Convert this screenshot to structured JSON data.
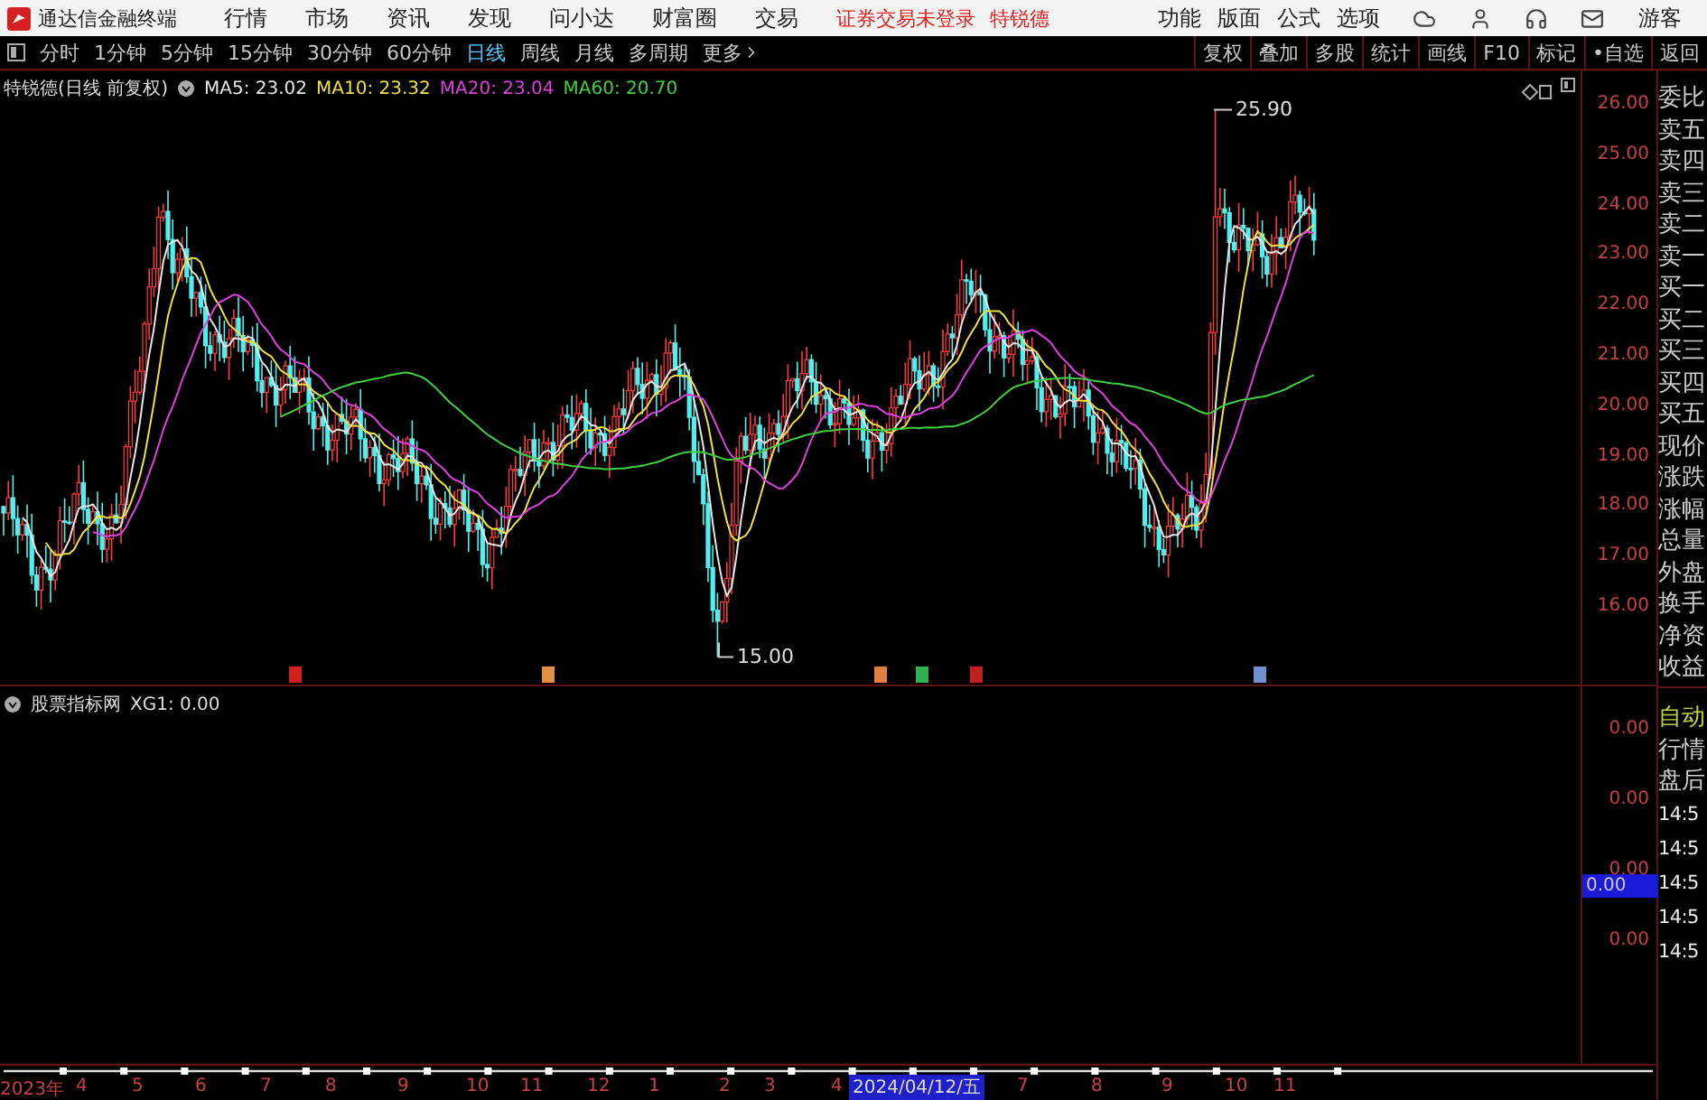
{
  "title_bar": {
    "app_name": "通达信金融终端",
    "menu": [
      "行情",
      "市场",
      "资讯",
      "发现",
      "问小达",
      "财富圈",
      "交易"
    ],
    "status": "证券交易未登录",
    "stock": "特锐德",
    "right_menu": [
      "功能",
      "版面",
      "公式",
      "选项"
    ],
    "user": "游客"
  },
  "period_tabs": [
    {
      "label": "分时",
      "selected": false
    },
    {
      "label": "1分钟",
      "selected": false
    },
    {
      "label": "5分钟",
      "selected": false
    },
    {
      "label": "15分钟",
      "selected": false
    },
    {
      "label": "30分钟",
      "selected": false
    },
    {
      "label": "60分钟",
      "selected": false
    },
    {
      "label": "日线",
      "selected": true
    },
    {
      "label": "周线",
      "selected": false
    },
    {
      "label": "月线",
      "selected": false
    },
    {
      "label": "多周期",
      "selected": false
    },
    {
      "label": "更多",
      "selected": false
    }
  ],
  "tools": [
    "复权",
    "叠加",
    "多股",
    "统计",
    "画线",
    "F10",
    "标记",
    "•自选",
    "返回"
  ],
  "price_panel": {
    "title": "特锐德(日线 前复权)",
    "moving_averages": [
      {
        "label": "MA5: 23.02",
        "color": "#e6e6e6"
      },
      {
        "label": "MA10: 23.32",
        "color": "#f0e040"
      },
      {
        "label": "MA20: 23.04",
        "color": "#e040e0"
      },
      {
        "label": "MA60: 20.70",
        "color": "#40d040"
      }
    ],
    "high_label": "25.90",
    "low_label": "15.00",
    "axis_labels": [
      "26.00",
      "25.00",
      "24.00",
      "23.00",
      "22.00",
      "21.00",
      "20.00",
      "19.00",
      "18.00",
      "17.00",
      "16.00"
    ]
  },
  "indicator_panel": {
    "title": "股票指标网",
    "reading": "XG1: 0.00",
    "axis_labels": [
      "0.00",
      "0.00",
      "0.00",
      "0.00"
    ],
    "cursor_value": "0.00"
  },
  "time_axis": {
    "labels": [
      "2023年",
      "4",
      "5",
      "6",
      "7",
      "8",
      "9",
      "10",
      "11",
      "12",
      "1",
      "2",
      "3",
      "4",
      "7",
      "8",
      "9",
      "10",
      "11"
    ],
    "cursor_date": "2024/04/12/五"
  },
  "sidebar": {
    "quote_fields": [
      "委比",
      "卖五",
      "卖四",
      "卖三",
      "卖二",
      "卖一",
      "买一",
      "买二",
      "买三",
      "买四",
      "买五",
      "现价",
      "涨跌",
      "涨幅",
      "总量",
      "外盘",
      "换手",
      "净资",
      "收益"
    ],
    "tick_header": [
      "自动",
      "行情",
      "盘后"
    ],
    "tick_times": [
      "14:5",
      "14:5",
      "14:5",
      "14:5",
      "14:5"
    ]
  }
}
